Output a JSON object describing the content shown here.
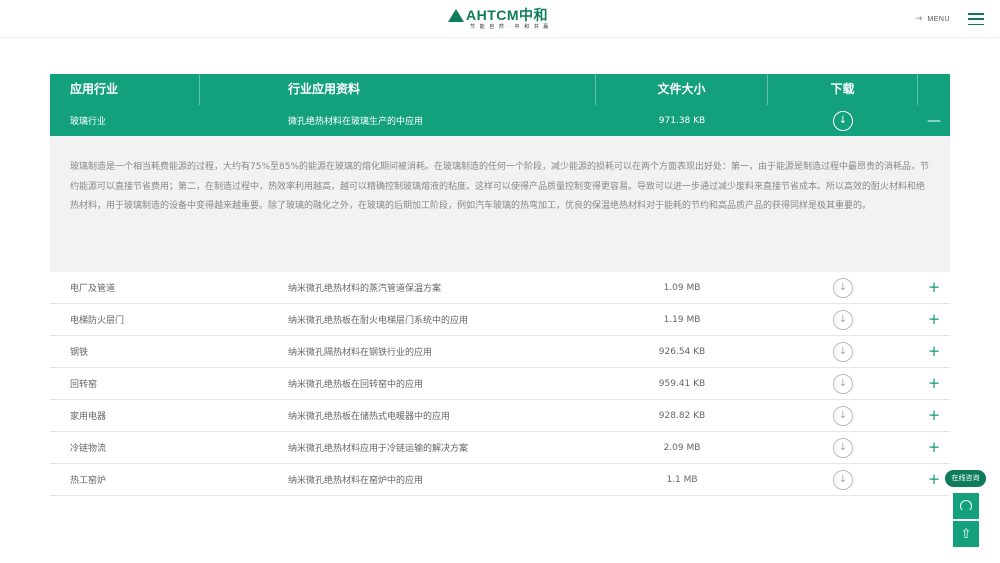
{
  "header": {
    "logo_text": "AHTCM中和",
    "logo_sub": "节 能 自 然 · 中 和 共 赢",
    "menu_label": "MENU"
  },
  "table": {
    "headers": {
      "industry": "应用行业",
      "material": "行业应用资料",
      "size": "文件大小",
      "download": "下载"
    },
    "active_row": {
      "industry": "玻璃行业",
      "material": "微孔绝热材料在玻璃生产的中应用",
      "size": "971.38 KB",
      "toggle": "—"
    },
    "detail_text": "玻璃制造是一个相当耗费能源的过程，大约有75%至85%的能源在玻璃的熔化期间被消耗。在玻璃制造的任何一个阶段，减少能源的损耗可以在两个方面表现出好处：第一，由于能源是制造过程中最昂贵的消耗品，节约能源可以直接节省费用；第二，在制造过程中，热效率利用越高，越可以精确控制玻璃熔液的粘度。这样可以使得产品质量控制变得更容易。导致可以进一步通过减少废料来直接节省成本。所以高效的耐火材料和绝热材料，用于玻璃制造的设备中变得越来越重要。除了玻璃的融化之外，在玻璃的后期加工阶段，例如汽车玻璃的热弯加工，优良的保温绝热材料对于能耗的节约和高品质产品的获得同样是极其重要的。",
    "rows": [
      {
        "industry": "电厂及管道",
        "material": "纳米微孔绝热材料的蒸汽管道保温方案",
        "size": "1.09 MB",
        "toggle": "+"
      },
      {
        "industry": "电梯防火层门",
        "material": "纳米微孔绝热板在耐火电梯层门系统中的应用",
        "size": "1.19 MB",
        "toggle": "+"
      },
      {
        "industry": "钢铁",
        "material": "纳米微孔隔热材料在钢铁行业的应用",
        "size": "926.54 KB",
        "toggle": "+"
      },
      {
        "industry": "回转窑",
        "material": "纳米微孔绝热板在回转窑中的应用",
        "size": "959.41 KB",
        "toggle": "+"
      },
      {
        "industry": "家用电器",
        "material": "纳米微孔绝热板在储热式电暖器中的应用",
        "size": "928.82 KB",
        "toggle": "+"
      },
      {
        "industry": "冷链物流",
        "material": "纳米微孔绝热材料应用于冷链运输的解决方案",
        "size": "2.09 MB",
        "toggle": "+"
      },
      {
        "industry": "热工窑炉",
        "material": "纳米微孔绝热材料在窑炉中的应用",
        "size": "1.1 MB",
        "toggle": "+"
      }
    ]
  },
  "side": {
    "consult_label": "在线咨询"
  },
  "icons": {
    "download": "download-icon",
    "headset": "headset-icon",
    "upload": "upload-icon"
  },
  "colors": {
    "brand": "#0e7c5b",
    "accent": "#12a17c"
  }
}
